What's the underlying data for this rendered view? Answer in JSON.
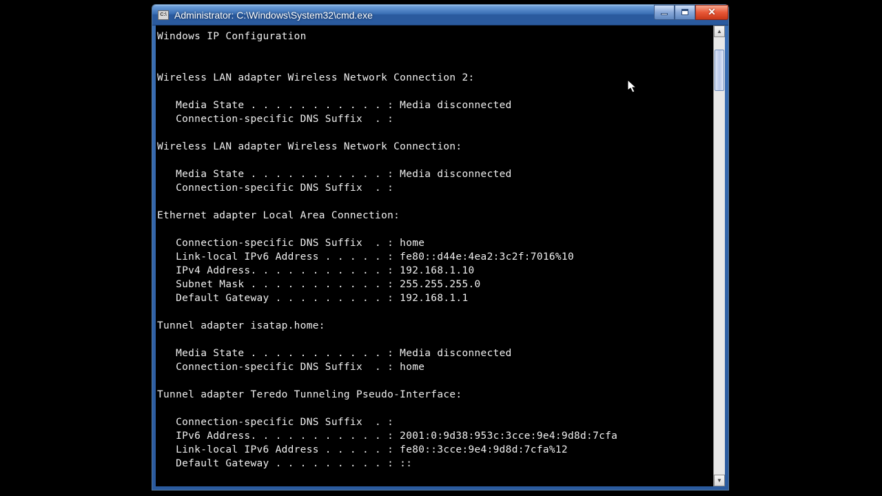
{
  "window": {
    "title": "Administrator: C:\\Windows\\System32\\cmd.exe",
    "icon_label": "C:\\"
  },
  "console": {
    "header": "Windows IP Configuration",
    "adapters": [
      {
        "name": "Wireless LAN adapter Wireless Network Connection 2:",
        "lines": [
          "   Media State . . . . . . . . . . . : Media disconnected",
          "   Connection-specific DNS Suffix  . :"
        ]
      },
      {
        "name": "Wireless LAN adapter Wireless Network Connection:",
        "lines": [
          "   Media State . . . . . . . . . . . : Media disconnected",
          "   Connection-specific DNS Suffix  . :"
        ]
      },
      {
        "name": "Ethernet adapter Local Area Connection:",
        "lines": [
          "   Connection-specific DNS Suffix  . : home",
          "   Link-local IPv6 Address . . . . . : fe80::d44e:4ea2:3c2f:7016%10",
          "   IPv4 Address. . . . . . . . . . . : 192.168.1.10",
          "   Subnet Mask . . . . . . . . . . . : 255.255.255.0",
          "   Default Gateway . . . . . . . . . : 192.168.1.1"
        ]
      },
      {
        "name": "Tunnel adapter isatap.home:",
        "lines": [
          "   Media State . . . . . . . . . . . : Media disconnected",
          "   Connection-specific DNS Suffix  . : home"
        ]
      },
      {
        "name": "Tunnel adapter Teredo Tunneling Pseudo-Interface:",
        "lines": [
          "   Connection-specific DNS Suffix  . :",
          "   IPv6 Address. . . . . . . . . . . : 2001:0:9d38:953c:3cce:9e4:9d8d:7cfa",
          "   Link-local IPv6 Address . . . . . : fe80::3cce:9e4:9d8d:7cfa%12",
          "   Default Gateway . . . . . . . . . : ::"
        ]
      }
    ]
  }
}
